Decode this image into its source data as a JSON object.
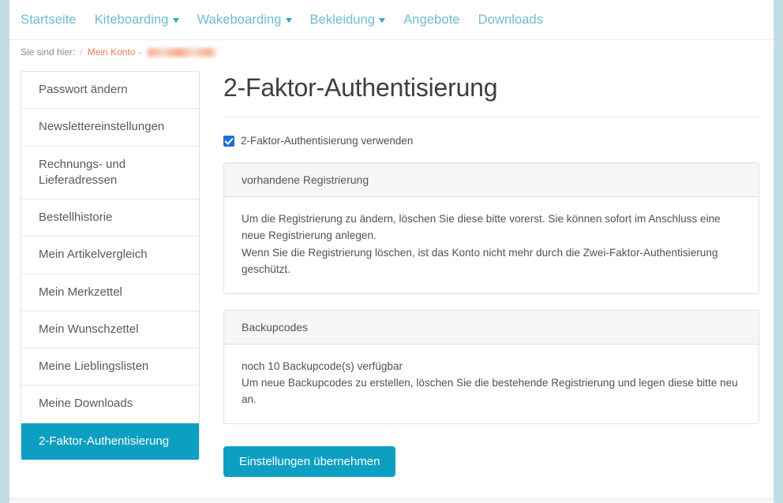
{
  "topnav": {
    "items": [
      {
        "label": "Startseite",
        "has_caret": false
      },
      {
        "label": "Kiteboarding",
        "has_caret": true
      },
      {
        "label": "Wakeboarding",
        "has_caret": true
      },
      {
        "label": "Bekleidung",
        "has_caret": true
      },
      {
        "label": "Angebote",
        "has_caret": false
      },
      {
        "label": "Downloads",
        "has_caret": false
      }
    ]
  },
  "breadcrumb": {
    "prefix": "Sie sind hier:",
    "separator": "/",
    "link": "Mein Konto -",
    "redacted_value": ""
  },
  "sidebar": {
    "items": [
      {
        "label": "Passwort ändern",
        "active": false
      },
      {
        "label": "Newslettereinstellungen",
        "active": false
      },
      {
        "label": "Rechnungs- und Lieferadressen",
        "active": false
      },
      {
        "label": "Bestellhistorie",
        "active": false
      },
      {
        "label": "Mein Artikelvergleich",
        "active": false
      },
      {
        "label": "Mein Merkzettel",
        "active": false
      },
      {
        "label": "Mein Wunschzettel",
        "active": false
      },
      {
        "label": "Meine Lieblingslisten",
        "active": false
      },
      {
        "label": "Meine Downloads",
        "active": false
      },
      {
        "label": "2-Faktor-Authentisierung",
        "active": true
      }
    ]
  },
  "main": {
    "title": "2-Faktor-Authentisierung",
    "checkbox": {
      "label": "2-Faktor-Authentisierung verwenden",
      "checked": true
    },
    "panels": [
      {
        "heading": "vorhandene Registrierung",
        "lines": [
          "Um die Registrierung zu ändern, löschen Sie diese bitte vorerst. Sie können sofort im Anschluss eine neue Registrierung anlegen.",
          "Wenn Sie die Registrierung löschen, ist das Konto nicht mehr durch die Zwei-Faktor-Authentisierung geschützt."
        ]
      },
      {
        "heading": "Backupcodes",
        "lines": [
          "noch 10 Backupcode(s) verfügbar",
          "Um neue Backupcodes zu erstellen, löschen Sie die bestehende Registrierung und legen diese bitte neu an."
        ]
      }
    ],
    "submit_label": "Einstellungen übernehmen"
  },
  "colors": {
    "accent_teal": "#0d9fc2",
    "nav_link": "#6ebbd2",
    "breadcrumb_link": "#ea7b4e",
    "checkbox_blue": "#1f6fd0",
    "page_edge": "#c3dde7"
  }
}
